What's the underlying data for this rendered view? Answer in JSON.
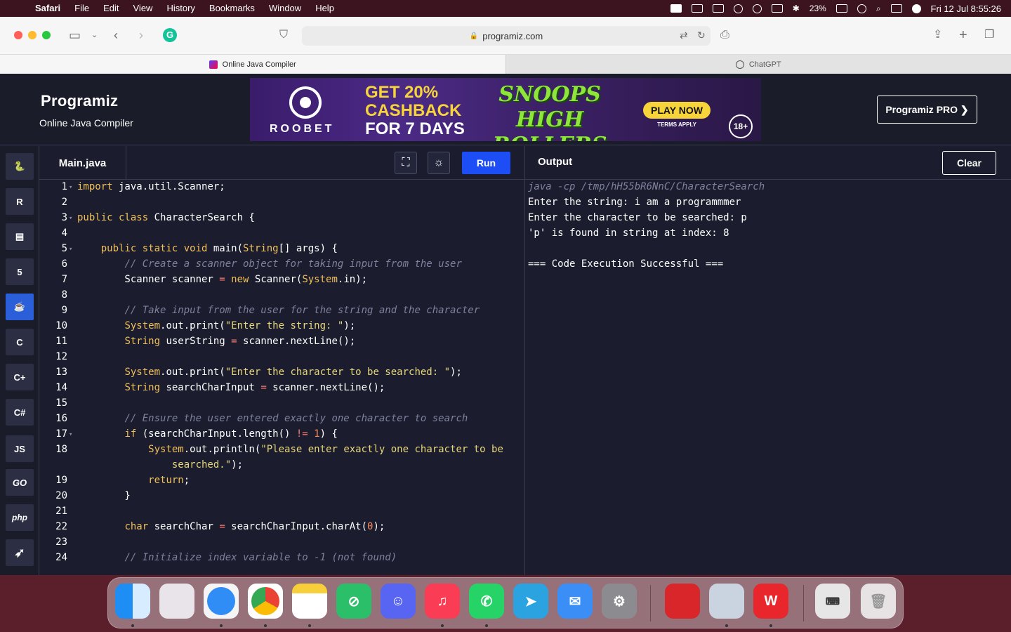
{
  "menubar": {
    "apple": "",
    "items": [
      "Safari",
      "File",
      "Edit",
      "View",
      "History",
      "Bookmarks",
      "Window",
      "Help"
    ],
    "battery": "23%",
    "datetime": "Fri 12 Jul  8:55:26"
  },
  "browser": {
    "url": "programiz.com",
    "tabs": [
      {
        "label": "Online Java Compiler",
        "active": true
      },
      {
        "label": "ChatGPT",
        "active": false
      }
    ]
  },
  "site": {
    "logo": "Programiz",
    "subtitle": "Online Java Compiler",
    "pro_button": "Programiz PRO ❯",
    "ad": {
      "brand": "ROOBET",
      "headline1": "GET 20%",
      "headline2": "CASHBACK",
      "headline3": "FOR 7 DAYS",
      "game_line1": "SNOOPS",
      "game_line2": "HIGH ROLLERS",
      "cta": "PLAY NOW",
      "terms": "TERMS APPLY",
      "age": "18+"
    }
  },
  "sidebar": {
    "languages": [
      {
        "name": "python",
        "label": "🐍"
      },
      {
        "name": "r",
        "label": "R"
      },
      {
        "name": "sql",
        "label": "▤"
      },
      {
        "name": "html",
        "label": "5"
      },
      {
        "name": "java",
        "label": "☕"
      },
      {
        "name": "c",
        "label": "C"
      },
      {
        "name": "cpp",
        "label": "C+"
      },
      {
        "name": "csharp",
        "label": "C#"
      },
      {
        "name": "js",
        "label": "JS"
      },
      {
        "name": "go",
        "label": "GO"
      },
      {
        "name": "php",
        "label": "php"
      },
      {
        "name": "swift",
        "label": "➶"
      }
    ]
  },
  "editor": {
    "filename": "Main.java",
    "run_label": "Run",
    "fullscreen_icon": "⛶",
    "theme_icon": "☼",
    "line_numbers": [
      "1",
      "2",
      "3",
      "4",
      "5",
      "6",
      "7",
      "8",
      "9",
      "10",
      "11",
      "12",
      "13",
      "14",
      "15",
      "16",
      "17",
      "18",
      "",
      "19",
      "20",
      "21",
      "22",
      "23",
      "24"
    ]
  },
  "output": {
    "title": "Output",
    "clear_label": "Clear",
    "lines": [
      "java -cp /tmp/hH55bR6NnC/CharacterSearch",
      "Enter the string: i am a programmmer",
      "Enter the character to be searched: p",
      "'p' is found in string at index: 8",
      "",
      "=== Code Execution Successful ==="
    ]
  },
  "dock": {
    "apps": [
      "finder",
      "launchpad",
      "safari",
      "chrome",
      "notes",
      "unknown-green",
      "discord",
      "music",
      "whatsapp",
      "telegram",
      "mail",
      "system-settings",
      "photo-booth",
      "preview",
      "wps",
      "keyboard",
      "trash"
    ]
  }
}
